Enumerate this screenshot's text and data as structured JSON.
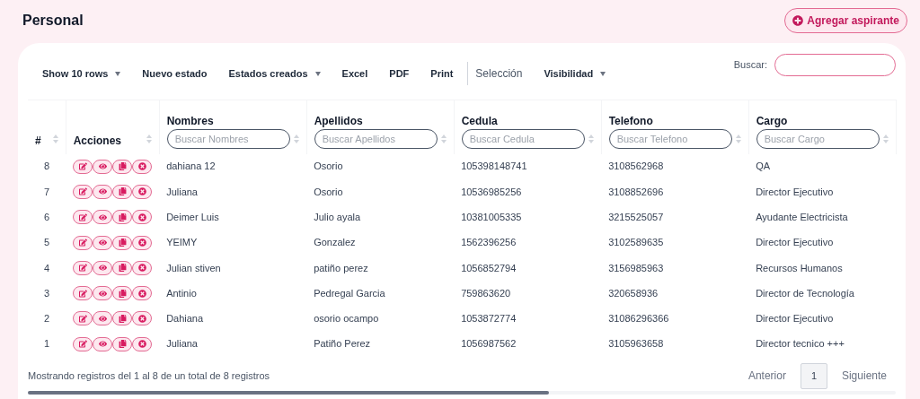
{
  "page_title": "Personal",
  "add_button": {
    "label": "Agregar aspirante"
  },
  "toolbar": [
    {
      "label": "Show 10 rows",
      "kind": "dropdown"
    },
    {
      "label": "Nuevo estado",
      "kind": "button"
    },
    {
      "label": "Estados creados",
      "kind": "dropdown"
    },
    {
      "label": "Excel",
      "kind": "button"
    },
    {
      "label": "PDF",
      "kind": "button"
    },
    {
      "label": "Print",
      "kind": "button"
    },
    {
      "label": "Selección",
      "kind": "plain"
    },
    {
      "label": "Visibilidad",
      "kind": "dropdown"
    }
  ],
  "search": {
    "label": "Buscar:"
  },
  "table": {
    "columns": [
      {
        "label": "#"
      },
      {
        "label": "Acciones"
      },
      {
        "label": "Nombres",
        "placeholder": "Buscar Nombres"
      },
      {
        "label": "Apellidos",
        "placeholder": "Buscar Apellidos"
      },
      {
        "label": "Cedula",
        "placeholder": "Buscar Cedula"
      },
      {
        "label": "Telefono",
        "placeholder": "Buscar Telefono"
      },
      {
        "label": "Cargo",
        "placeholder": "Buscar Cargo"
      }
    ],
    "rows": [
      [
        "8",
        "",
        "dahiana 12",
        "Osorio",
        "105398148741",
        "3108562968",
        "QA"
      ],
      [
        "7",
        "",
        "Juliana",
        "Osorio",
        "10536985256",
        "3108852696",
        "Director Ejecutivo"
      ],
      [
        "6",
        "",
        "Deimer Luis",
        "Julio ayala",
        "10381005335",
        "3215525057",
        "Ayudante Electricista"
      ],
      [
        "5",
        "",
        "YEIMY",
        "Gonzalez",
        "1562396256",
        "3102589635",
        "Director Ejecutivo"
      ],
      [
        "4",
        "",
        "Julian stiven",
        "patiño perez",
        "1056852794",
        "3156985963",
        "Recursos Humanos"
      ],
      [
        "3",
        "",
        "Antinio",
        "Pedregal Garcia",
        "759863620",
        "320658936",
        "Director de Tecnología"
      ],
      [
        "2",
        "",
        "Dahiana",
        "osorio ocampo",
        "1053872774",
        "31086296366",
        "Director Ejecutivo"
      ],
      [
        "1",
        "",
        "Juliana",
        "Patiño Perez",
        "1056987562",
        "3105963658",
        "Director tecnico +++"
      ]
    ]
  },
  "footer": {
    "info": "Mostrando registros del 1 al 8 de un total de 8 registros",
    "pagination": [
      {
        "label": "Anterior",
        "kind": "link",
        "selected": false
      },
      {
        "label": "1",
        "kind": "page",
        "selected": true
      },
      {
        "label": "Siguiente",
        "kind": "link",
        "selected": false
      }
    ]
  }
}
